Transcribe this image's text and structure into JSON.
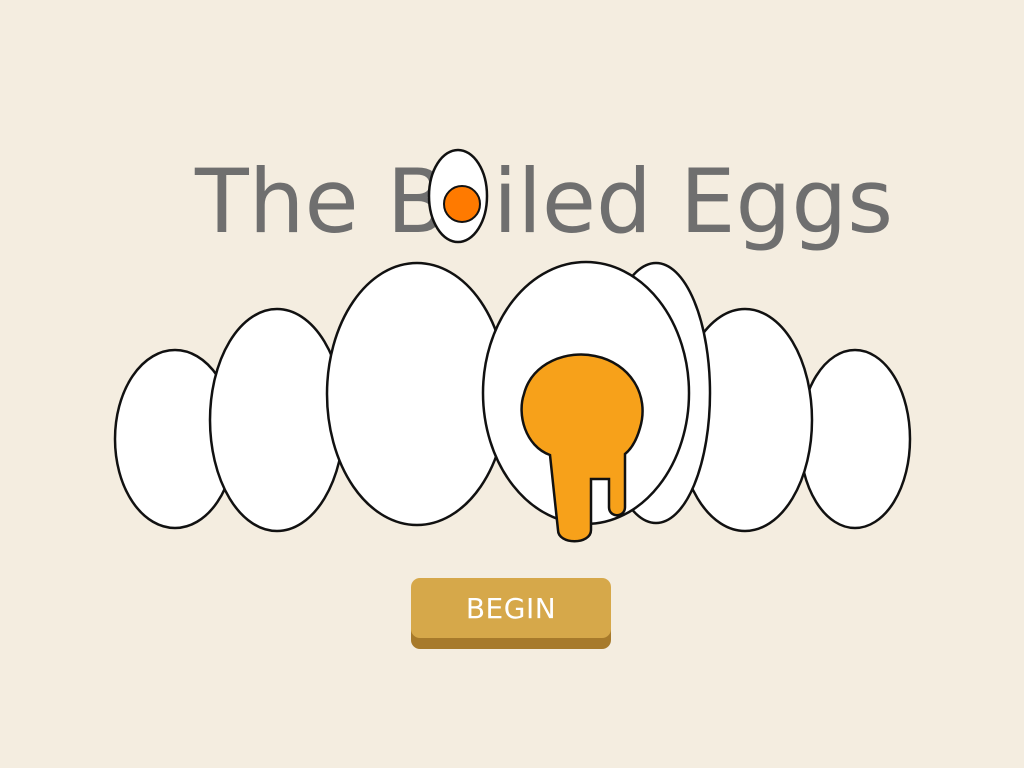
{
  "game": {
    "title_part1": "The B",
    "title_part2": "iled Eggs",
    "button_label": "BEGIN"
  },
  "colors": {
    "background": "#f4ede0",
    "title_text": "#6f6f6f",
    "yolk": "#f7a11a",
    "title_egg_yolk": "#ff7a00",
    "button_face": "#d6a84a",
    "button_shadow": "#a77a2b"
  }
}
